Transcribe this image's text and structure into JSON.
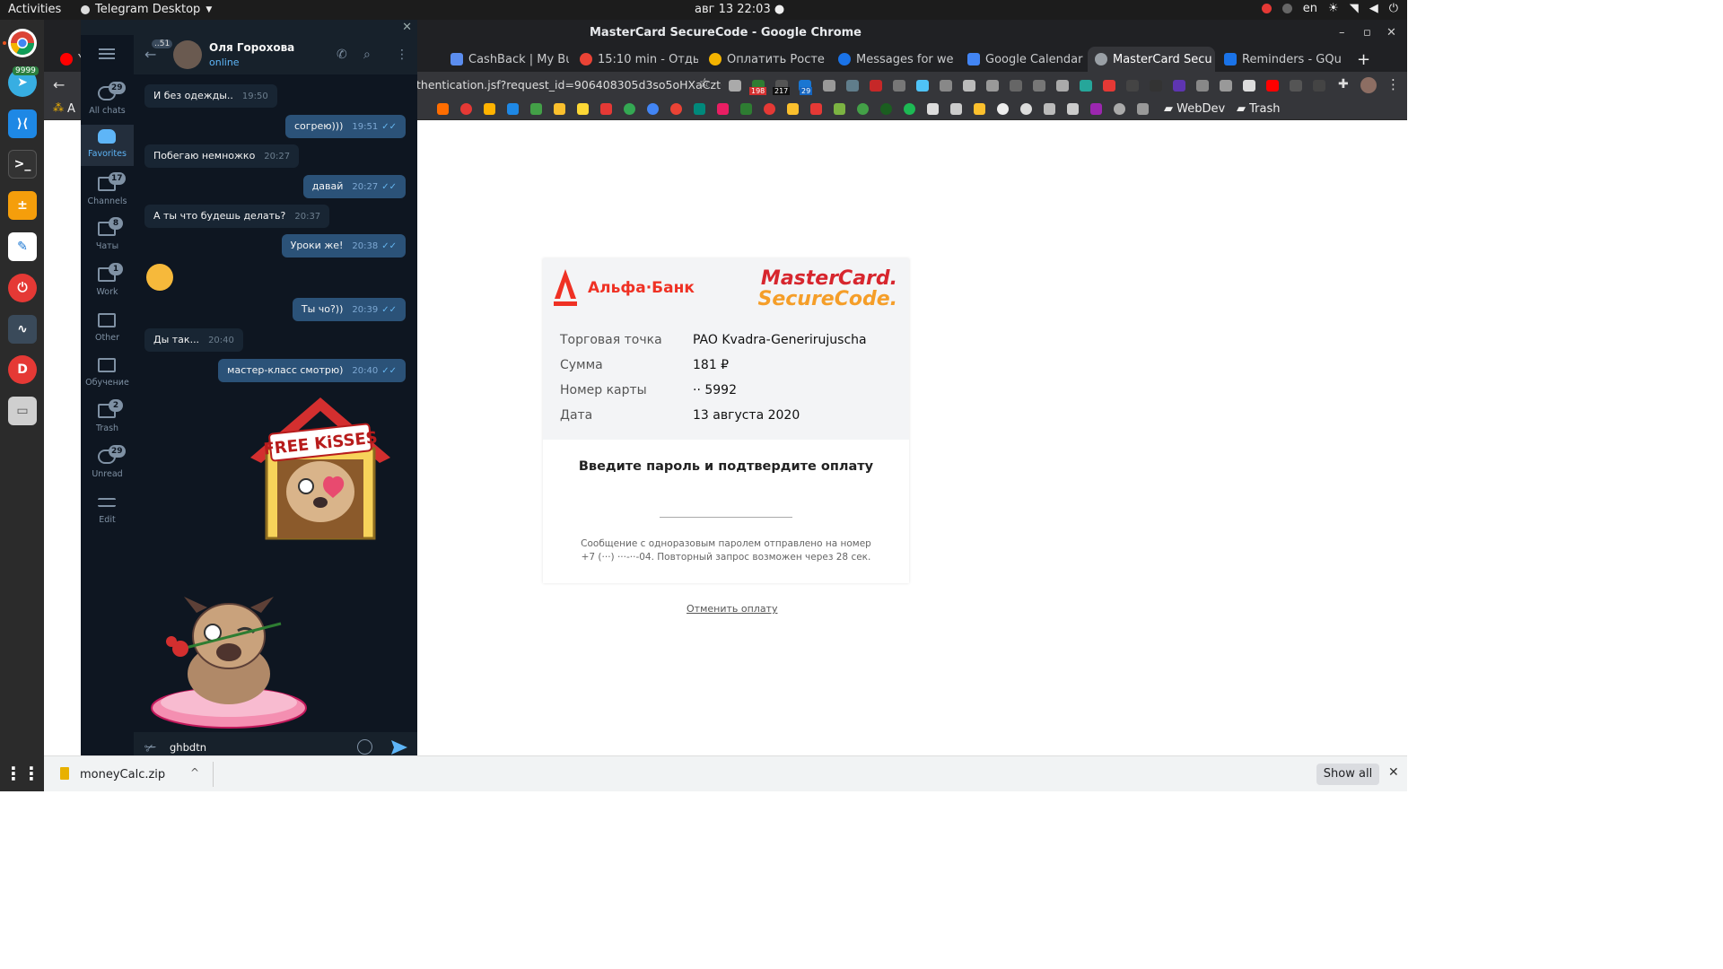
{
  "topbar": {
    "activities": "Activities",
    "app_menu": "Telegram Desktop",
    "clock": "авг 13  22:03",
    "lang": "en"
  },
  "dock": {
    "telegram_badge": "9999",
    "items": [
      "chrome-icon",
      "telegram-icon",
      "vscode-icon",
      "terminal-icon",
      "calculator-icon",
      "text-editor-icon",
      "power-icon",
      "system-monitor-icon",
      "dbeaver-icon",
      "files-icon",
      "show-apps-icon"
    ]
  },
  "chrome": {
    "window_title": "MasterCard SecureCode - Google Chrome",
    "tabs": [
      {
        "label": "Y",
        "icon": "youtube-icon",
        "color": "#ff0000"
      },
      {
        "label": "CashBack | My Bu",
        "icon": "cashback-icon",
        "color": "#1a73e8"
      },
      {
        "label": "15:10 min - Отды",
        "icon": "timer-icon",
        "color": "#ea4335"
      },
      {
        "label": "Оплатить Росте",
        "icon": "payment-icon",
        "color": "#f4b400"
      },
      {
        "label": "Messages for we",
        "icon": "messages-icon",
        "color": "#1a73e8"
      },
      {
        "label": "Google Calendar",
        "icon": "calendar-icon",
        "color": "#4285f4"
      },
      {
        "label": "MasterCard Secu",
        "icon": "globe-icon",
        "color": "#9aa0a6"
      },
      {
        "label": "Reminders - GQu",
        "icon": "reminders-icon",
        "color": "#1a73e8"
      }
    ],
    "url": "thentication.jsf?request_id=906408305d3so5oHXaCzt6...",
    "extension_badges": [
      "198",
      "217",
      "29"
    ],
    "bookmarks": {
      "first": "A",
      "webdev": "WebDev",
      "trash": "Trash"
    }
  },
  "payment": {
    "bank_name": "Альфа·Банк",
    "mc_line1": "MasterCard.",
    "mc_line2": "SecureCode.",
    "rows": [
      {
        "label": "Торговая точка",
        "value": "PAO Kvadra-Generirujuscha"
      },
      {
        "label": "Сумма",
        "value": "181 ₽"
      },
      {
        "label": "Номер карты",
        "value": "·· 5992"
      },
      {
        "label": "Дата",
        "value": "13 августа 2020"
      }
    ],
    "password_title": "Введите пароль и подтвердите оплату",
    "sms_note": "Сообщение с одноразовым паролем отправлено на номер +7 (···) ···-··-04. Повторный запрос возможен через 28 сек.",
    "cancel_link": "Отменить оплату"
  },
  "telegram": {
    "contact_name": "Оля Горохова",
    "status": "online",
    "back_badge": "..51",
    "folders": [
      {
        "label": "All chats",
        "badge": "29"
      },
      {
        "label": "Favorites",
        "badge": ""
      },
      {
        "label": "Channels",
        "badge": "17"
      },
      {
        "label": "Чаты",
        "badge": "8"
      },
      {
        "label": "Work",
        "badge": "1"
      },
      {
        "label": "Other",
        "badge": ""
      },
      {
        "label": "Обучение",
        "badge": ""
      },
      {
        "label": "Trash",
        "badge": "2"
      },
      {
        "label": "Unread",
        "badge": "29"
      },
      {
        "label": "Edit",
        "badge": ""
      }
    ],
    "messages": [
      {
        "text": "И без одежды..",
        "time": "19:50",
        "out": false
      },
      {
        "text": "согрею)))",
        "time": "19:51",
        "out": true
      },
      {
        "text": "Побегаю немножко",
        "time": "20:27",
        "out": false
      },
      {
        "text": "давай",
        "time": "20:27",
        "out": true
      },
      {
        "text": "А ты что будешь делать?",
        "time": "20:37",
        "out": false
      },
      {
        "text": "Уроки же!",
        "time": "20:38",
        "out": true
      },
      {
        "text": "Ты чо?))",
        "time": "20:39",
        "out": true
      },
      {
        "text": "Ды так...",
        "time": "20:40",
        "out": false
      },
      {
        "text": "мастер-класс смотрю)",
        "time": "20:40",
        "out": true
      }
    ],
    "sticker_text": "FREE KiSSES",
    "composer_text": "ghbdtn"
  },
  "downloads": {
    "file": "moneyCalc.zip",
    "show_all": "Show all"
  }
}
